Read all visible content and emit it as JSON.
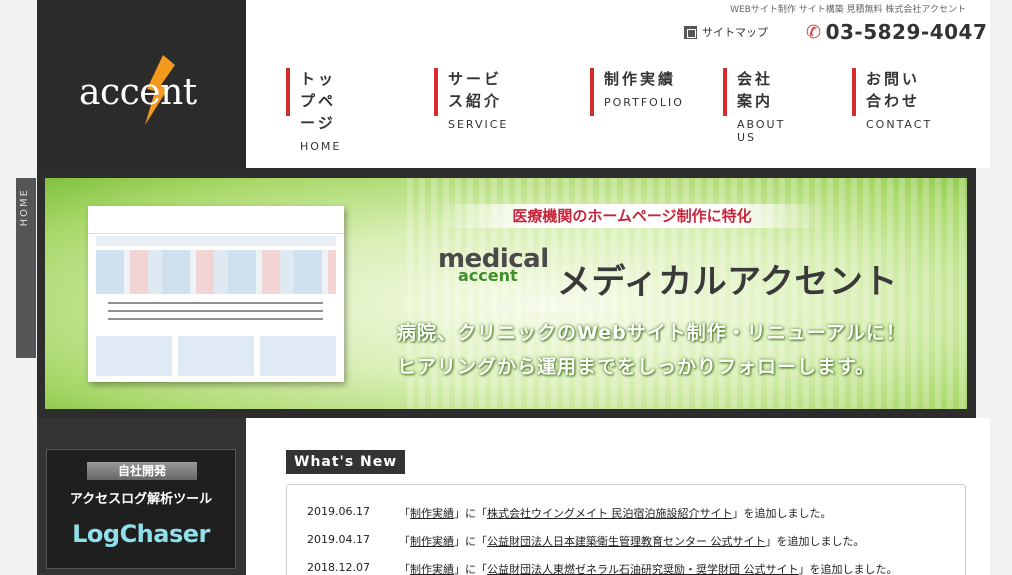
{
  "header": {
    "tagline": "WEBサイト制作 サイト構築 見積無料 株式会社アクセント",
    "sitemap_label": "サイトマップ",
    "phone": "03-5829-4047",
    "logo_text": "accent"
  },
  "nav": [
    {
      "jp": "トップページ",
      "en": "HOME"
    },
    {
      "jp": "サービス紹介",
      "en": "SERVICE"
    },
    {
      "jp": "制作実績",
      "en": "PORTFOLIO"
    },
    {
      "jp": "会社案内",
      "en": "ABOUT US"
    },
    {
      "jp": "お問い合わせ",
      "en": "CONTACT"
    }
  ],
  "side_tab": "HOME",
  "banner": {
    "ribbon": "医療機関のホームページ制作に特化",
    "brand_line1": "medical",
    "brand_line2": "accent",
    "title": "メディカルアクセント",
    "copy_line1": "病院、クリニックのWebサイト制作・リニューアルに！",
    "copy_line2": "ヒアリングから運用までをしっかりフォローします。"
  },
  "slider": {
    "count": 4,
    "active_index": 0
  },
  "whats_new": {
    "heading": "What's New",
    "items": [
      {
        "date": "2019.06.17",
        "category": "制作実績",
        "target": "株式会社ウイングメイト 民泊宿泊施設紹介サイト"
      },
      {
        "date": "2019.04.17",
        "category": "制作実績",
        "target": "公益財団法人日本建築衛生管理教育センター 公式サイト"
      },
      {
        "date": "2018.12.07",
        "category": "制作実績",
        "target": "公益財団法人東燃ゼネラル石油研究奨励・奨学財団 公式サイト"
      }
    ],
    "text_a": "「",
    "text_b": "」に「",
    "text_c": "」を追加しました。"
  },
  "promo": {
    "caption": "自社開発",
    "title": "アクセスログ解析ツール",
    "logo": "LogChaser"
  },
  "colors": {
    "accent": "#d62c2c",
    "banner_green": "#a9d86a",
    "dark": "#333333"
  }
}
